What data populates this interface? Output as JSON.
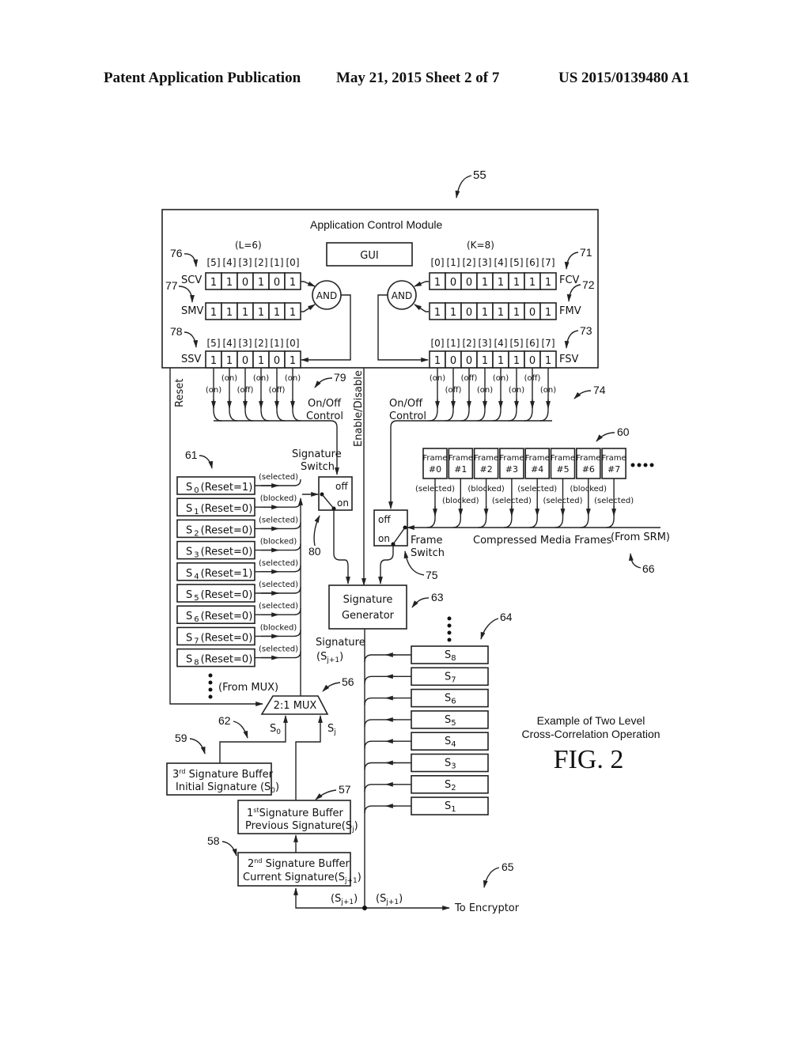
{
  "header": {
    "left": "Patent Application Publication",
    "middle": "May 21, 2015  Sheet 2 of 7",
    "right": "US 2015/0139480 A1"
  },
  "figure": {
    "ref": "55",
    "module_title": "Application Control Module",
    "gui_label": "GUI",
    "caption_line1": "Example of Two Level",
    "caption_line2": "Cross-Correlation Operation",
    "fig_label": "FIG. 2"
  },
  "signature_vectors": {
    "length_label": "(L=6)",
    "indices": [
      "[5]",
      "[4]",
      "[3]",
      "[2]",
      "[1]",
      "[0]"
    ],
    "scv": {
      "name": "SCV",
      "ref": "76",
      "bits": [
        "1",
        "1",
        "0",
        "1",
        "0",
        "1"
      ]
    },
    "smv": {
      "name": "SMV",
      "ref": "77",
      "bits": [
        "1",
        "1",
        "1",
        "1",
        "1",
        "1"
      ]
    },
    "ssv": {
      "name": "SSV",
      "ref": "78",
      "bits": [
        "1",
        "1",
        "0",
        "1",
        "0",
        "1"
      ]
    },
    "and_label": "AND",
    "outputs": [
      "(on)",
      "(on)",
      "(off)",
      "(on)",
      "(off)",
      "(on)"
    ],
    "control_label_1": "On/Off",
    "control_label_2": "Control",
    "control_ref": "79"
  },
  "frame_vectors": {
    "length_label": "(K=8)",
    "indices": [
      "[0]",
      "[1]",
      "[2]",
      "[3]",
      "[4]",
      "[5]",
      "[6]",
      "[7]"
    ],
    "fcv": {
      "name": "FCV",
      "ref": "71",
      "bits": [
        "1",
        "0",
        "0",
        "1",
        "1",
        "1",
        "1",
        "1"
      ]
    },
    "fmv": {
      "name": "FMV",
      "ref": "72",
      "bits": [
        "1",
        "1",
        "0",
        "1",
        "1",
        "1",
        "0",
        "1"
      ]
    },
    "fsv": {
      "name": "FSV",
      "ref": "73",
      "bits": [
        "1",
        "0",
        "0",
        "1",
        "1",
        "1",
        "0",
        "1"
      ]
    },
    "and_label": "AND",
    "outputs": [
      "(on)",
      "(off)",
      "(off)",
      "(on)",
      "(on)",
      "(on)",
      "(off)",
      "(on)"
    ],
    "control_label_1": "On/Off",
    "control_label_2": "Control",
    "control_ref": "74"
  },
  "side_labels": {
    "reset": "Reset",
    "enable_disable": "Enable/Disable"
  },
  "frames": {
    "ref": "60",
    "items": [
      {
        "line1": "Frame",
        "line2": "#0",
        "state": "(selected)"
      },
      {
        "line1": "Frame",
        "line2": "#1",
        "state": "(blocked)"
      },
      {
        "line1": "Frame",
        "line2": "#2",
        "state": "(blocked)"
      },
      {
        "line1": "Frame",
        "line2": "#3",
        "state": "(selected)"
      },
      {
        "line1": "Frame",
        "line2": "#4",
        "state": "(selected)"
      },
      {
        "line1": "Frame",
        "line2": "#5",
        "state": "(selected)"
      },
      {
        "line1": "Frame",
        "line2": "#6",
        "state": "(blocked)"
      },
      {
        "line1": "Frame",
        "line2": "#7",
        "state": "(selected)"
      }
    ],
    "stream_label": "Compressed Media Frames",
    "source_label": "(From SRM)",
    "source_ref": "66"
  },
  "frame_switch": {
    "off": "off",
    "on": "on",
    "label1": "Frame",
    "label2": "Switch",
    "ref": "75"
  },
  "signature_switch": {
    "label1": "Signature",
    "label2": "Switch",
    "off": "off",
    "on": "on",
    "ref": "80"
  },
  "signature_list": {
    "ref": "61",
    "items": [
      {
        "name": "S",
        "sub": "0",
        "reset": "(Reset=1)",
        "state": "(selected)"
      },
      {
        "name": "S",
        "sub": "1",
        "reset": "(Reset=0)",
        "state": "(blocked)"
      },
      {
        "name": "S",
        "sub": "2",
        "reset": "(Reset=0)",
        "state": "(selected)"
      },
      {
        "name": "S",
        "sub": "3",
        "reset": "(Reset=0)",
        "state": "(blocked)"
      },
      {
        "name": "S",
        "sub": "4",
        "reset": "(Reset=1)",
        "state": "(selected)"
      },
      {
        "name": "S",
        "sub": "5",
        "reset": "(Reset=0)",
        "state": "(selected)"
      },
      {
        "name": "S",
        "sub": "6",
        "reset": "(Reset=0)",
        "state": "(selected)"
      },
      {
        "name": "S",
        "sub": "7",
        "reset": "(Reset=0)",
        "state": "(blocked)"
      },
      {
        "name": "S",
        "sub": "8",
        "reset": "(Reset=0)",
        "state": "(selected)"
      }
    ],
    "from_label": "(From MUX)"
  },
  "generator": {
    "line1": "Signature",
    "line2": "Generator",
    "ref": "63",
    "output_label": "Signature",
    "output_sub": "(S",
    "output_sub_idx": "j+1",
    "output_close": ")"
  },
  "stored_signatures": {
    "ref": "64",
    "items": [
      {
        "name": "S",
        "sub": "8"
      },
      {
        "name": "S",
        "sub": "7"
      },
      {
        "name": "S",
        "sub": "6"
      },
      {
        "name": "S",
        "sub": "5"
      },
      {
        "name": "S",
        "sub": "4"
      },
      {
        "name": "S",
        "sub": "3"
      },
      {
        "name": "S",
        "sub": "2"
      },
      {
        "name": "S",
        "sub": "1"
      }
    ]
  },
  "mux": {
    "label": "2:1 MUX",
    "ref": "56",
    "input_a": "S",
    "input_a_sub": "0",
    "input_b": "S",
    "input_b_sub": "j"
  },
  "buffers": {
    "third": {
      "ordinal": "3",
      "sup": "rd",
      "line1": " Signature Buffer",
      "line2": "Initial Signature (S",
      "line2_sub": "0",
      "line2_end": ")",
      "ref": "59",
      "wire_ref": "62"
    },
    "first": {
      "ordinal": "1",
      "sup": "st",
      "line1": "Signature Buffer",
      "line2": "Previous Signature(S",
      "line2_sub": "j",
      "line2_end": ")",
      "ref": "57"
    },
    "second": {
      "ordinal": "2",
      "sup": "nd",
      "line1": " Signature Buffer",
      "line2": "Current Signature(S",
      "line2_sub": "j+1",
      "line2_end": ")",
      "ref": "58"
    }
  },
  "output": {
    "label_a": "(S",
    "label_a_sub": "j+1",
    "label_b": "(S",
    "label_b_sub": "j+1",
    "close": ")",
    "destination": "To Encryptor",
    "ref": "65"
  }
}
